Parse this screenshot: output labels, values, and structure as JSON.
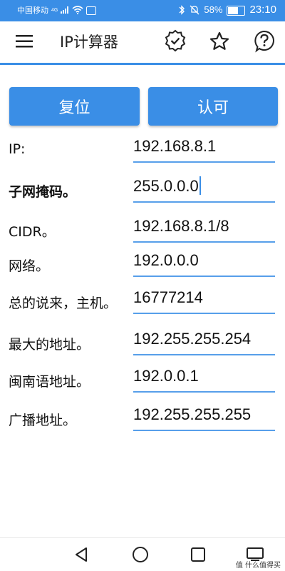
{
  "status_bar": {
    "carrier": "中国移动",
    "signal": "4G",
    "battery": "58%",
    "battery_level": 0.58,
    "time": "23:10"
  },
  "app_bar": {
    "title": "IP计算器",
    "icons": [
      "menu-icon",
      "verified-icon",
      "star-icon",
      "help-icon"
    ]
  },
  "buttons": {
    "reset": "复位",
    "ok": "认可"
  },
  "rows": [
    {
      "label": "IP:",
      "value": "192.168.8.1"
    },
    {
      "label": "子网掩码。",
      "value": "255.0.0.0"
    },
    {
      "label": "CIDR。",
      "value": "192.168.8.1/8"
    },
    {
      "label": "网络。",
      "value": "192.0.0.0"
    },
    {
      "label": "总的说来，主机。",
      "value": "16777214"
    },
    {
      "label": "最大的地址。",
      "value": "192.255.255.254"
    },
    {
      "label": "闽南语地址。",
      "value": "192.0.0.1"
    },
    {
      "label": "广播地址。",
      "value": "192.255.255.255"
    }
  ],
  "nav_bar": {
    "icons": [
      "back-icon",
      "home-icon",
      "recent-apps-icon",
      "screen-icon"
    ]
  },
  "watermark": "值 什么值得买",
  "colors": {
    "accent": "#3a8ee6",
    "text": "#111111",
    "background": "#ffffff"
  }
}
